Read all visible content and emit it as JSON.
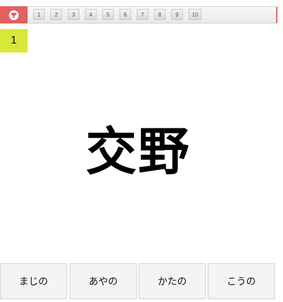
{
  "toolbar": {
    "home_icon": "trophy-icon",
    "tabs": [
      "1",
      "2",
      "3",
      "4",
      "5",
      "6",
      "7",
      "8",
      "9",
      "10"
    ]
  },
  "question": {
    "number": "1",
    "kanji": "交野"
  },
  "choices": [
    "まじの",
    "あやの",
    "かたの",
    "こうの"
  ],
  "colors": {
    "home": "#e06161",
    "badge": "#d7e83a"
  }
}
